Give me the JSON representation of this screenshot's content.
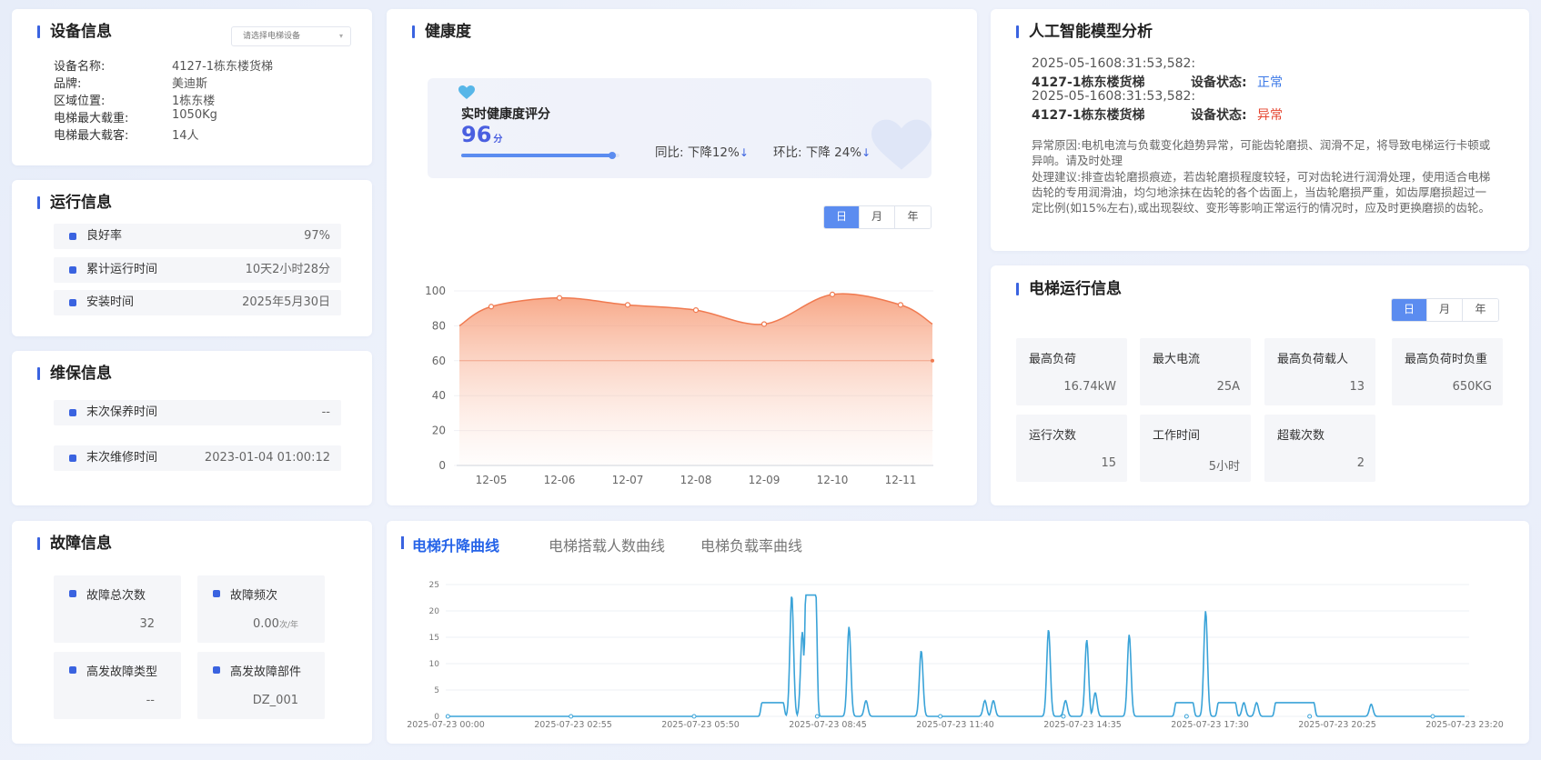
{
  "device": {
    "title": "设备信息",
    "select_placeholder": "请选择电梯设备",
    "rows": [
      {
        "k": "设备名称:",
        "v": "4127-1栋东楼货梯"
      },
      {
        "k": "品牌:",
        "v": "美迪斯"
      },
      {
        "k": "区域位置:",
        "v": "1栋东楼"
      },
      {
        "k": "电梯最大载重:",
        "v": "1050Kg"
      },
      {
        "k": "电梯最大载客:",
        "v": "14人"
      }
    ]
  },
  "run": {
    "title": "运行信息",
    "rows": [
      {
        "label": "良好率",
        "value": "97%"
      },
      {
        "label": "累计运行时间",
        "value": "10天2小时28分"
      },
      {
        "label": "安装时间",
        "value": "2025年5月30日"
      }
    ]
  },
  "maintenance": {
    "title": "维保信息",
    "rows": [
      {
        "label": "末次保养时间",
        "value": "--"
      },
      {
        "label": "末次维修时间",
        "value": "2023-01-04 01:00:12"
      }
    ]
  },
  "fault": {
    "title": "故障信息",
    "tiles": [
      {
        "label": "故障总次数",
        "value": "32",
        "unit": ""
      },
      {
        "label": "故障频次",
        "value": "0.00",
        "unit": "次/年"
      },
      {
        "label": "高发故障类型",
        "value": "--",
        "unit": ""
      },
      {
        "label": "高发故障部件",
        "value": "DZ_001",
        "unit": ""
      }
    ]
  },
  "health": {
    "title": "健康度",
    "score_label": "实时健康度评分",
    "score": "96",
    "score_unit": "分",
    "score_progress": 0.96,
    "yoy": "同比:  下降12%",
    "mom": "环比:  下降 24%",
    "periods": [
      "日",
      "月",
      "年"
    ],
    "active_period": 0
  },
  "ai": {
    "title": "人工智能模型分析",
    "entries": [
      {
        "time": "2025-05-1608:31:53,582:",
        "device": "4127-1栋东楼货梯",
        "status_label": "设备状态:",
        "status": "正常",
        "status_color": "#3b78e7"
      },
      {
        "time": "2025-05-1608:31:53,582:",
        "device": "4127-1栋东楼货梯",
        "status_label": "设备状态:",
        "status": "异常",
        "status_color": "#e5432e"
      }
    ],
    "reason": "异常原因:电机电流与负载变化趋势异常，可能齿轮磨损、润滑不足，将导致电梯运行卡顿或异响。请及时处理",
    "advice": "处理建议:排查齿轮磨损痕迹，若齿轮磨损程度较轻，可对齿轮进行润滑处理，使用适合电梯齿轮的专用润滑油，均匀地涂抹在齿轮的各个齿面上，当齿轮磨损严重，如齿厚磨损超过一定比例(如15%左右),或出现裂纹、变形等影响正常运行的情况时，应及时更换磨损的齿轮。"
  },
  "elevator": {
    "title": "电梯运行信息",
    "periods": [
      "日",
      "月",
      "年"
    ],
    "active_period": 0,
    "stats": [
      {
        "label": "最高负荷",
        "value": "16.74kW"
      },
      {
        "label": "最大电流",
        "value": "25A"
      },
      {
        "label": "最高负荷载人",
        "value": "13"
      },
      {
        "label": "最高负荷时负重",
        "value": "650KG"
      },
      {
        "label": "运行次数",
        "value": "15"
      },
      {
        "label": "工作时间",
        "value": "5小时"
      },
      {
        "label": "超载次数",
        "value": "2"
      }
    ]
  },
  "curves": {
    "tabs": [
      "电梯升降曲线",
      "电梯搭载人数曲线",
      "电梯负载率曲线"
    ],
    "active_tab": 0
  },
  "colors": {
    "accent": "#3a63e0",
    "health_line": "#f07a50",
    "curve_line": "#3aa3d8",
    "normal": "#3b78e7",
    "abnormal": "#e5432e"
  },
  "chart_data": [
    {
      "type": "area",
      "x": [
        "12-05",
        "12-06",
        "12-07",
        "12-08",
        "12-09",
        "12-10",
        "12-11"
      ],
      "series": [
        {
          "values": [
            91,
            96,
            92,
            89,
            81,
            98,
            92
          ]
        }
      ],
      "start_value": 80,
      "end_value": 81,
      "reference_line": 60,
      "ylim": [
        0,
        100
      ],
      "yticks": [
        0,
        20,
        40,
        60,
        80,
        100
      ]
    },
    {
      "type": "line",
      "x_ticks": [
        "2025-07-23 00:00",
        "2025-07-23 02:55",
        "2025-07-23 05:50",
        "2025-07-23 08:45",
        "2025-07-23 11:40",
        "2025-07-23 14:35",
        "2025-07-23 17:30",
        "2025-07-23 20:25",
        "2025-07-23 23:20"
      ],
      "ylim": [
        0,
        25
      ],
      "yticks": [
        0,
        5,
        10,
        15,
        20,
        25
      ],
      "x_range_hours": [
        0,
        24
      ],
      "events": [
        {
          "t": 7.7,
          "v": 2.6,
          "w": 0.25,
          "flat": true
        },
        {
          "t": 8.15,
          "v": 23
        },
        {
          "t": 8.4,
          "v": 16
        },
        {
          "t": 8.6,
          "v": 23,
          "w": 0.12,
          "flat": true
        },
        {
          "t": 9.5,
          "v": 17
        },
        {
          "t": 9.9,
          "v": 3
        },
        {
          "t": 11.2,
          "v": 12.5
        },
        {
          "t": 12.7,
          "v": 3
        },
        {
          "t": 12.9,
          "v": 3
        },
        {
          "t": 14.2,
          "v": 16.5
        },
        {
          "t": 14.6,
          "v": 3
        },
        {
          "t": 15.1,
          "v": 14.5
        },
        {
          "t": 15.3,
          "v": 4.5
        },
        {
          "t": 16.1,
          "v": 15.5
        },
        {
          "t": 17.4,
          "v": 2.6,
          "w": 0.2,
          "flat": true
        },
        {
          "t": 17.9,
          "v": 20
        },
        {
          "t": 18.4,
          "v": 2.6,
          "w": 0.2,
          "flat": true
        },
        {
          "t": 18.8,
          "v": 2.6
        },
        {
          "t": 19.1,
          "v": 2.6
        },
        {
          "t": 20.0,
          "v": 2.6,
          "w": 0.45,
          "flat": true
        },
        {
          "t": 21.8,
          "v": 2.3
        }
      ],
      "markers": [
        0.05,
        2.95,
        5.85,
        8.75,
        11.65,
        14.55,
        17.45,
        20.35,
        23.25
      ]
    }
  ]
}
